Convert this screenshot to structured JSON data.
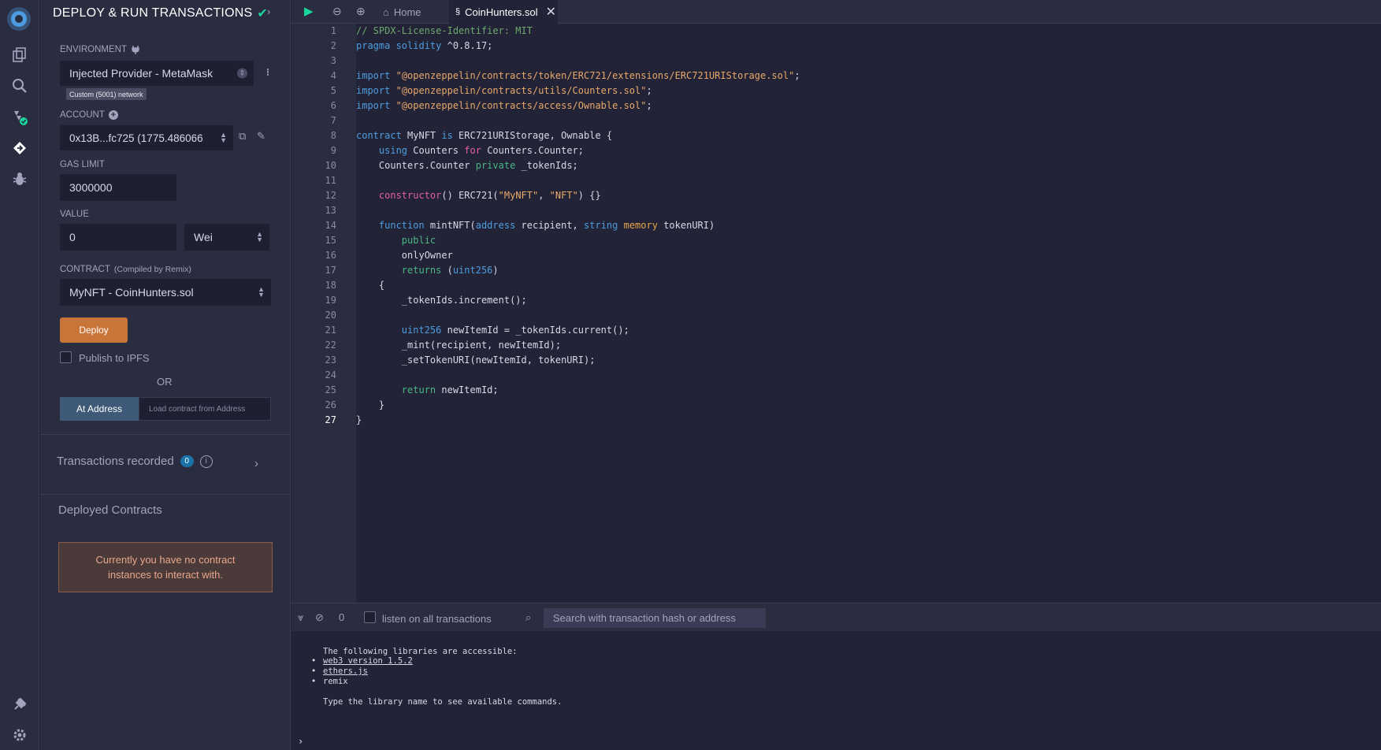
{
  "colors": {
    "accent": "#c97539",
    "success": "#1bd79e",
    "bg": "#222336",
    "panel": "#2a2c3f"
  },
  "rail": {
    "icons": [
      "remix-logo-icon",
      "file-explorer-icon",
      "search-icon",
      "solidity-compiler-icon",
      "deploy-run-icon",
      "debugger-icon",
      "plugin-manager-icon",
      "settings-icon"
    ]
  },
  "panel": {
    "title": "DEPLOY & RUN TRANSACTIONS",
    "environment_label": "ENVIRONMENT",
    "environment_value": "Injected Provider - MetaMask",
    "network_badge": "Custom (5001) network",
    "account_label": "ACCOUNT",
    "account_value": "0x13B...fc725 (1775.486066",
    "gas_limit_label": "GAS LIMIT",
    "gas_limit_value": "3000000",
    "value_label": "VALUE",
    "value_amount": "0",
    "value_unit": "Wei",
    "contract_label": "CONTRACT",
    "contract_label_note": "(Compiled by Remix)",
    "contract_value": "MyNFT - CoinHunters.sol",
    "deploy_label": "Deploy",
    "publish_ipfs_label": "Publish to IPFS",
    "or_label": "OR",
    "at_address_label": "At Address",
    "at_address_placeholder": "Load contract from Address",
    "transactions_recorded_label": "Transactions recorded",
    "transactions_recorded_count": "0",
    "deployed_contracts_label": "Deployed Contracts",
    "no_instances_message": "Currently you have no contract instances to interact with."
  },
  "tabs": {
    "home_label": "Home",
    "file_label": "CoinHunters.sol"
  },
  "editor": {
    "current_line": 27,
    "lines": [
      [
        [
          "cmt",
          "// SPDX-License-Identifier: MIT"
        ]
      ],
      [
        [
          "kw-blue",
          "pragma solidity"
        ],
        [
          "plain",
          " ^0.8.17;"
        ]
      ],
      [],
      [
        [
          "kw-blue",
          "import"
        ],
        [
          "plain",
          " "
        ],
        [
          "str",
          "\"@openzeppelin/contracts/token/ERC721/extensions/ERC721URIStorage.sol\""
        ],
        [
          "plain",
          ";"
        ]
      ],
      [
        [
          "kw-blue",
          "import"
        ],
        [
          "plain",
          " "
        ],
        [
          "str",
          "\"@openzeppelin/contracts/utils/Counters.sol\""
        ],
        [
          "plain",
          ";"
        ]
      ],
      [
        [
          "kw-blue",
          "import"
        ],
        [
          "plain",
          " "
        ],
        [
          "str",
          "\"@openzeppelin/contracts/access/Ownable.sol\""
        ],
        [
          "plain",
          ";"
        ]
      ],
      [],
      [
        [
          "kw-blue",
          "contract"
        ],
        [
          "plain",
          " MyNFT "
        ],
        [
          "kw-blue",
          "is"
        ],
        [
          "plain",
          " ERC721URIStorage, Ownable {"
        ]
      ],
      [
        [
          "plain",
          "    "
        ],
        [
          "kw-blue",
          "using"
        ],
        [
          "plain",
          " Counters "
        ],
        [
          "kw-pink",
          "for"
        ],
        [
          "plain",
          " Counters.Counter;"
        ]
      ],
      [
        [
          "plain",
          "    Counters.Counter "
        ],
        [
          "kw-green",
          "private"
        ],
        [
          "plain",
          " _tokenIds;"
        ]
      ],
      [],
      [
        [
          "plain",
          "    "
        ],
        [
          "kw-pink",
          "constructor"
        ],
        [
          "plain",
          "() ERC721("
        ],
        [
          "str",
          "\"MyNFT\""
        ],
        [
          "plain",
          ", "
        ],
        [
          "str",
          "\"NFT\""
        ],
        [
          "plain",
          ") {}"
        ]
      ],
      [],
      [
        [
          "plain",
          "    "
        ],
        [
          "kw-blue",
          "function"
        ],
        [
          "plain",
          " mintNFT("
        ],
        [
          "kw-blue",
          "address"
        ],
        [
          "plain",
          " recipient, "
        ],
        [
          "kw-blue",
          "string"
        ],
        [
          "plain",
          " "
        ],
        [
          "kw-orange",
          "memory"
        ],
        [
          "plain",
          " tokenURI)"
        ]
      ],
      [
        [
          "plain",
          "        "
        ],
        [
          "kw-green",
          "public"
        ]
      ],
      [
        [
          "plain",
          "        onlyOwner"
        ]
      ],
      [
        [
          "plain",
          "        "
        ],
        [
          "kw-green",
          "returns"
        ],
        [
          "plain",
          " ("
        ],
        [
          "kw-blue",
          "uint256"
        ],
        [
          "plain",
          ")"
        ]
      ],
      [
        [
          "plain",
          "    {"
        ]
      ],
      [
        [
          "plain",
          "        _tokenIds.increment();"
        ]
      ],
      [],
      [
        [
          "plain",
          "        "
        ],
        [
          "kw-blue",
          "uint256"
        ],
        [
          "plain",
          " newItemId = _tokenIds.current();"
        ]
      ],
      [
        [
          "plain",
          "        _mint(recipient, newItemId);"
        ]
      ],
      [
        [
          "plain",
          "        _setTokenURI(newItemId, tokenURI);"
        ]
      ],
      [],
      [
        [
          "plain",
          "        "
        ],
        [
          "kw-green",
          "return"
        ],
        [
          "plain",
          " newItemId;"
        ]
      ],
      [
        [
          "plain",
          "    }"
        ]
      ],
      [
        [
          "plain",
          "}"
        ]
      ]
    ]
  },
  "terminal": {
    "pending_count": "0",
    "listen_label": "listen on all transactions",
    "search_placeholder": "Search with transaction hash or address",
    "libraries_intro": "The following libraries are accessible:",
    "libraries": [
      "web3 version 1.5.2",
      "ethers.js",
      "remix"
    ],
    "hint": "Type the library name to see available commands.",
    "prompt": "›"
  }
}
